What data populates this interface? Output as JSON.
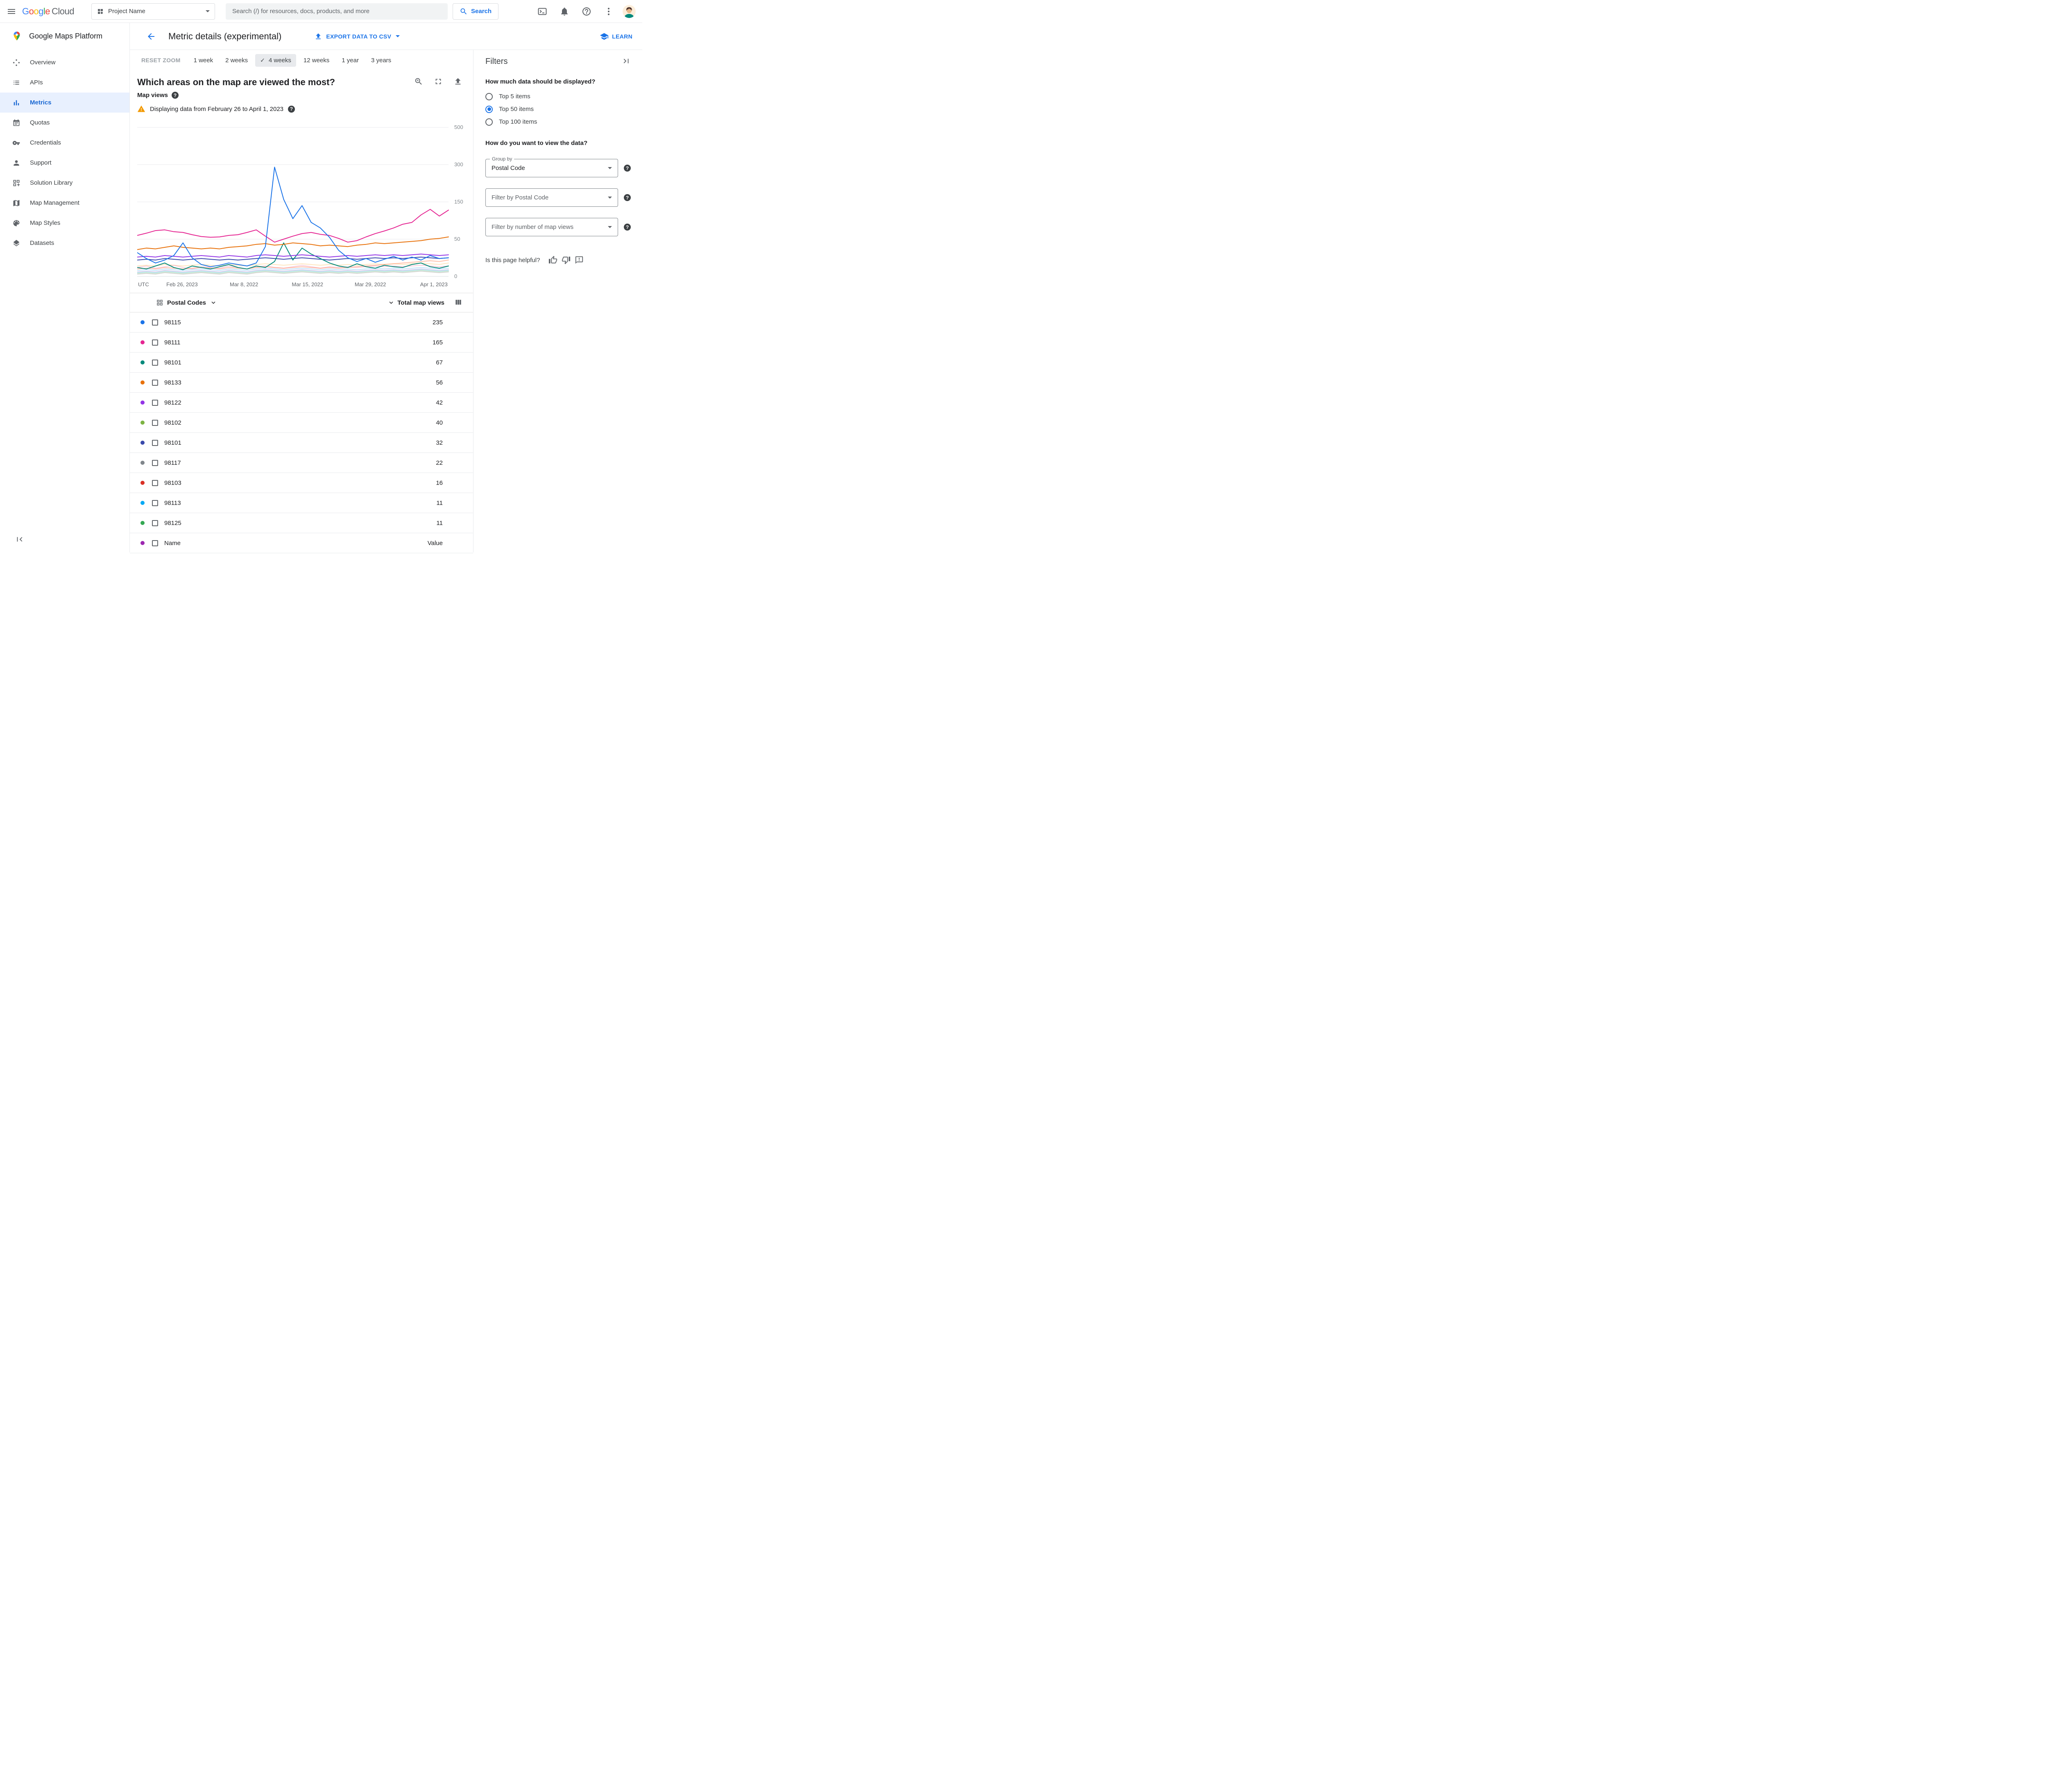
{
  "topbar": {
    "logo_text": "Google Cloud",
    "project_selector": {
      "label": "Project Name"
    },
    "search": {
      "placeholder": "Search (/) for resources, docs, products, and more",
      "button_label": "Search"
    }
  },
  "sidebar": {
    "product_title": "Google Maps Platform",
    "items": [
      {
        "id": "sidebar-item-overview",
        "label": "Overview",
        "icon": "overview-icon",
        "active": false
      },
      {
        "id": "sidebar-item-apis",
        "label": "APIs",
        "icon": "apis-icon",
        "active": false
      },
      {
        "id": "sidebar-item-metrics",
        "label": "Metrics",
        "icon": "metrics-icon",
        "active": true
      },
      {
        "id": "sidebar-item-quotas",
        "label": "Quotas",
        "icon": "quotas-icon",
        "active": false
      },
      {
        "id": "sidebar-item-credentials",
        "label": "Credentials",
        "icon": "credentials-icon",
        "active": false
      },
      {
        "id": "sidebar-item-support",
        "label": "Support",
        "icon": "support-icon",
        "active": false
      },
      {
        "id": "sidebar-item-solution-library",
        "label": "Solution Library",
        "icon": "solution-library-icon",
        "active": false
      },
      {
        "id": "sidebar-item-map-management",
        "label": "Map Management",
        "icon": "map-management-icon",
        "active": false
      },
      {
        "id": "sidebar-item-map-styles",
        "label": "Map Styles",
        "icon": "map-styles-icon",
        "active": false
      },
      {
        "id": "sidebar-item-datasets",
        "label": "Datasets",
        "icon": "datasets-icon",
        "active": false
      }
    ]
  },
  "page_header": {
    "title": "Metric details (experimental)",
    "export_button": "EXPORT DATA TO CSV",
    "learn_link": "LEARN"
  },
  "time_ranges": {
    "reset_label": "RESET ZOOM",
    "options": [
      {
        "label": "1 week",
        "active": false
      },
      {
        "label": "2 weeks",
        "active": false
      },
      {
        "label": "4 weeks",
        "active": true
      },
      {
        "label": "12 weeks",
        "active": false
      },
      {
        "label": "1 year",
        "active": false
      },
      {
        "label": "3 years",
        "active": false
      }
    ]
  },
  "chart_header": {
    "title": "Which areas on the map are viewed the most?",
    "metric_label": "Map views",
    "warning": "Displaying data from February 26 to April 1, 2023",
    "timezone": "UTC"
  },
  "chart_data": {
    "type": "line",
    "title": "Which areas on the map are viewed the most?",
    "ylabel": "Map views",
    "date_range": "February 26 to April 1, 2023",
    "y_ticks": [
      0,
      50,
      150,
      300,
      500
    ],
    "x_labels": [
      "Feb 26, 2023",
      "Mar 8, 2022",
      "Mar 15, 2022",
      "Mar 29, 2022",
      "Apr 1, 2023"
    ],
    "series": [
      {
        "name": "",
        "color": "#ffcc80",
        "opacity": 0.5,
        "values": [
          14,
          15,
          14,
          16,
          15,
          14,
          15,
          16,
          15,
          14,
          16,
          15,
          14,
          16,
          17,
          16,
          15,
          16,
          17,
          16,
          15,
          16,
          15,
          16,
          15,
          16,
          17,
          16,
          17,
          16,
          17,
          18,
          17,
          16,
          18
        ]
      },
      {
        "name": "",
        "color": "#f48fb1",
        "opacity": 0.45,
        "values": [
          12,
          14,
          11,
          13,
          15,
          12,
          10,
          13,
          12,
          11,
          14,
          12,
          10,
          13,
          14,
          12,
          11,
          13,
          15,
          13,
          11,
          13,
          12,
          13,
          12,
          13,
          14,
          13,
          14,
          13,
          14,
          15,
          14,
          13,
          14
        ]
      },
      {
        "name": "",
        "color": "#ff8a65",
        "opacity": 0.55,
        "values": [
          10,
          11,
          10,
          12,
          11,
          10,
          11,
          12,
          11,
          10,
          12,
          11,
          10,
          12,
          13,
          12,
          11,
          12,
          13,
          12,
          11,
          12,
          11,
          12,
          13,
          14,
          15,
          16,
          17,
          18,
          19,
          20,
          21,
          20,
          22
        ]
      },
      {
        "name": "",
        "color": "#90caf9",
        "opacity": 0.55,
        "values": [
          8,
          9,
          8,
          10,
          9,
          8,
          9,
          10,
          9,
          8,
          10,
          9,
          8,
          10,
          11,
          10,
          9,
          10,
          11,
          10,
          9,
          10,
          9,
          10,
          9,
          10,
          11,
          10,
          11,
          10,
          11,
          12,
          11,
          10,
          11
        ]
      },
      {
        "name": "",
        "color": "#80deea",
        "opacity": 0.55,
        "values": [
          5,
          6,
          5,
          7,
          6,
          5,
          6,
          7,
          6,
          5,
          7,
          6,
          5,
          7,
          8,
          7,
          6,
          7,
          8,
          7,
          6,
          7,
          6,
          7,
          6,
          7,
          8,
          7,
          8,
          7,
          8,
          9,
          8,
          7,
          8
        ]
      },
      {
        "name": "",
        "color": "#b39ddb",
        "opacity": 0.5,
        "values": [
          6,
          7,
          6,
          8,
          7,
          6,
          7,
          8,
          7,
          6,
          8,
          7,
          6,
          8,
          9,
          8,
          7,
          8,
          9,
          8,
          7,
          8,
          7,
          8,
          7,
          8,
          9,
          8,
          9,
          8,
          9,
          10,
          9,
          8,
          9
        ]
      },
      {
        "name": "",
        "color": "#a5d6a7",
        "opacity": 0.5,
        "values": [
          4,
          5,
          4,
          6,
          5,
          4,
          5,
          6,
          5,
          4,
          6,
          5,
          4,
          6,
          7,
          6,
          5,
          6,
          7,
          6,
          5,
          6,
          5,
          6,
          5,
          6,
          7,
          6,
          7,
          6,
          7,
          8,
          7,
          6,
          7
        ]
      },
      {
        "name": "",
        "color": "#bdbdbd",
        "opacity": 0.6,
        "values": [
          3,
          4,
          3,
          5,
          4,
          3,
          4,
          5,
          4,
          3,
          5,
          4,
          3,
          5,
          6,
          5,
          4,
          5,
          6,
          5,
          4,
          5,
          4,
          5,
          4,
          5,
          6,
          5,
          6,
          5,
          6,
          7,
          6,
          5,
          6
        ]
      },
      {
        "name": "98101",
        "color": "#3949ab",
        "opacity": 1,
        "values": [
          22,
          23,
          22,
          24,
          23,
          22,
          23,
          24,
          23,
          22,
          23,
          22,
          23,
          24,
          25,
          24,
          23,
          24,
          25,
          24,
          23,
          22,
          23,
          24,
          23,
          24,
          25,
          24,
          25,
          24,
          25,
          26,
          25,
          24,
          25
        ]
      },
      {
        "name": "98101",
        "color": "#00897b",
        "opacity": 1,
        "values": [
          12,
          10,
          14,
          18,
          12,
          9,
          14,
          12,
          10,
          13,
          16,
          12,
          10,
          14,
          12,
          20,
          45,
          22,
          38,
          30,
          24,
          18,
          14,
          12,
          17,
          13,
          11,
          15,
          13,
          12,
          16,
          18,
          13,
          11,
          14
        ]
      },
      {
        "name": "98122",
        "color": "#9334e6",
        "opacity": 1,
        "values": [
          26,
          27,
          26,
          28,
          27,
          26,
          27,
          28,
          27,
          26,
          28,
          27,
          26,
          28,
          29,
          28,
          27,
          28,
          29,
          28,
          27,
          26,
          27,
          28,
          27,
          28,
          29,
          28,
          29,
          28,
          29,
          30,
          29,
          28,
          29
        ]
      },
      {
        "name": "98133",
        "color": "#e8710a",
        "opacity": 1,
        "values": [
          36,
          38,
          37,
          39,
          41,
          39,
          38,
          37,
          38,
          37,
          39,
          40,
          41,
          43,
          44,
          42,
          43,
          45,
          44,
          43,
          41,
          42,
          41,
          40,
          42,
          43,
          45,
          44,
          45,
          46,
          47,
          48,
          50,
          52,
          56
        ]
      },
      {
        "name": "98111",
        "color": "#e52592",
        "opacity": 1,
        "values": [
          60,
          66,
          73,
          75,
          70,
          68,
          62,
          57,
          55,
          56,
          60,
          62,
          68,
          75,
          58,
          46,
          50,
          58,
          65,
          68,
          63,
          60,
          52,
          46,
          48,
          56,
          65,
          72,
          80,
          90,
          95,
          115,
          130,
          112,
          128
        ]
      },
      {
        "name": "98115",
        "color": "#1a73e8",
        "opacity": 1,
        "values": [
          32,
          24,
          18,
          22,
          28,
          45,
          25,
          16,
          13,
          15,
          18,
          16,
          14,
          18,
          40,
          290,
          160,
          105,
          140,
          95,
          80,
          55,
          35,
          25,
          20,
          24,
          19,
          23,
          27,
          22,
          26,
          22,
          28,
          24,
          25
        ]
      }
    ]
  },
  "table": {
    "group_header": "Postal Codes",
    "value_header": "Total map views",
    "rows": [
      {
        "code": "98115",
        "value": 235,
        "color": "#1a73e8"
      },
      {
        "code": "98111",
        "value": 165,
        "color": "#e52592"
      },
      {
        "code": "98101",
        "value": 67,
        "color": "#00897b"
      },
      {
        "code": "98133",
        "value": 56,
        "color": "#e8710a"
      },
      {
        "code": "98122",
        "value": 42,
        "color": "#9334e6"
      },
      {
        "code": "98102",
        "value": 40,
        "color": "#7cb342"
      },
      {
        "code": "98101",
        "value": 32,
        "color": "#3949ab"
      },
      {
        "code": "98117",
        "value": 22,
        "color": "#80868b"
      },
      {
        "code": "98103",
        "value": 16,
        "color": "#d93025"
      },
      {
        "code": "98113",
        "value": 11,
        "color": "#03a9f4"
      },
      {
        "code": "98125",
        "value": 11,
        "color": "#34a853"
      }
    ],
    "partial_row": {
      "code": "Name",
      "value": "Value",
      "color": "#9c27b0"
    }
  },
  "filters": {
    "title": "Filters",
    "data_amount_question": "How much data should be displayed?",
    "data_amount_options": [
      {
        "label": "Top 5 items",
        "selected": false
      },
      {
        "label": "Top 50 items",
        "selected": true
      },
      {
        "label": "Top 100 items",
        "selected": false
      }
    ],
    "view_question": "How do you want to view the data?",
    "group_by": {
      "label": "Group by",
      "value": "Postal Code"
    },
    "postal_filter": {
      "placeholder": "Filter by Postal Code"
    },
    "views_filter": {
      "placeholder": "Filter by number of map views"
    },
    "helpful_prompt": "Is this page helpful?"
  },
  "colors": {
    "accent": "#1a73e8",
    "google_letters": [
      "#4285F4",
      "#EA4335",
      "#FBBC05",
      "#4285F4",
      "#34A853",
      "#EA4335"
    ],
    "active_nav_bg": "#e8f0fe",
    "active_nav_text": "#1967d2",
    "warning": "#f29900",
    "text_primary": "#202124",
    "text_secondary": "#5f6368",
    "border": "#dadce0",
    "gridline": "#e8eaed"
  }
}
